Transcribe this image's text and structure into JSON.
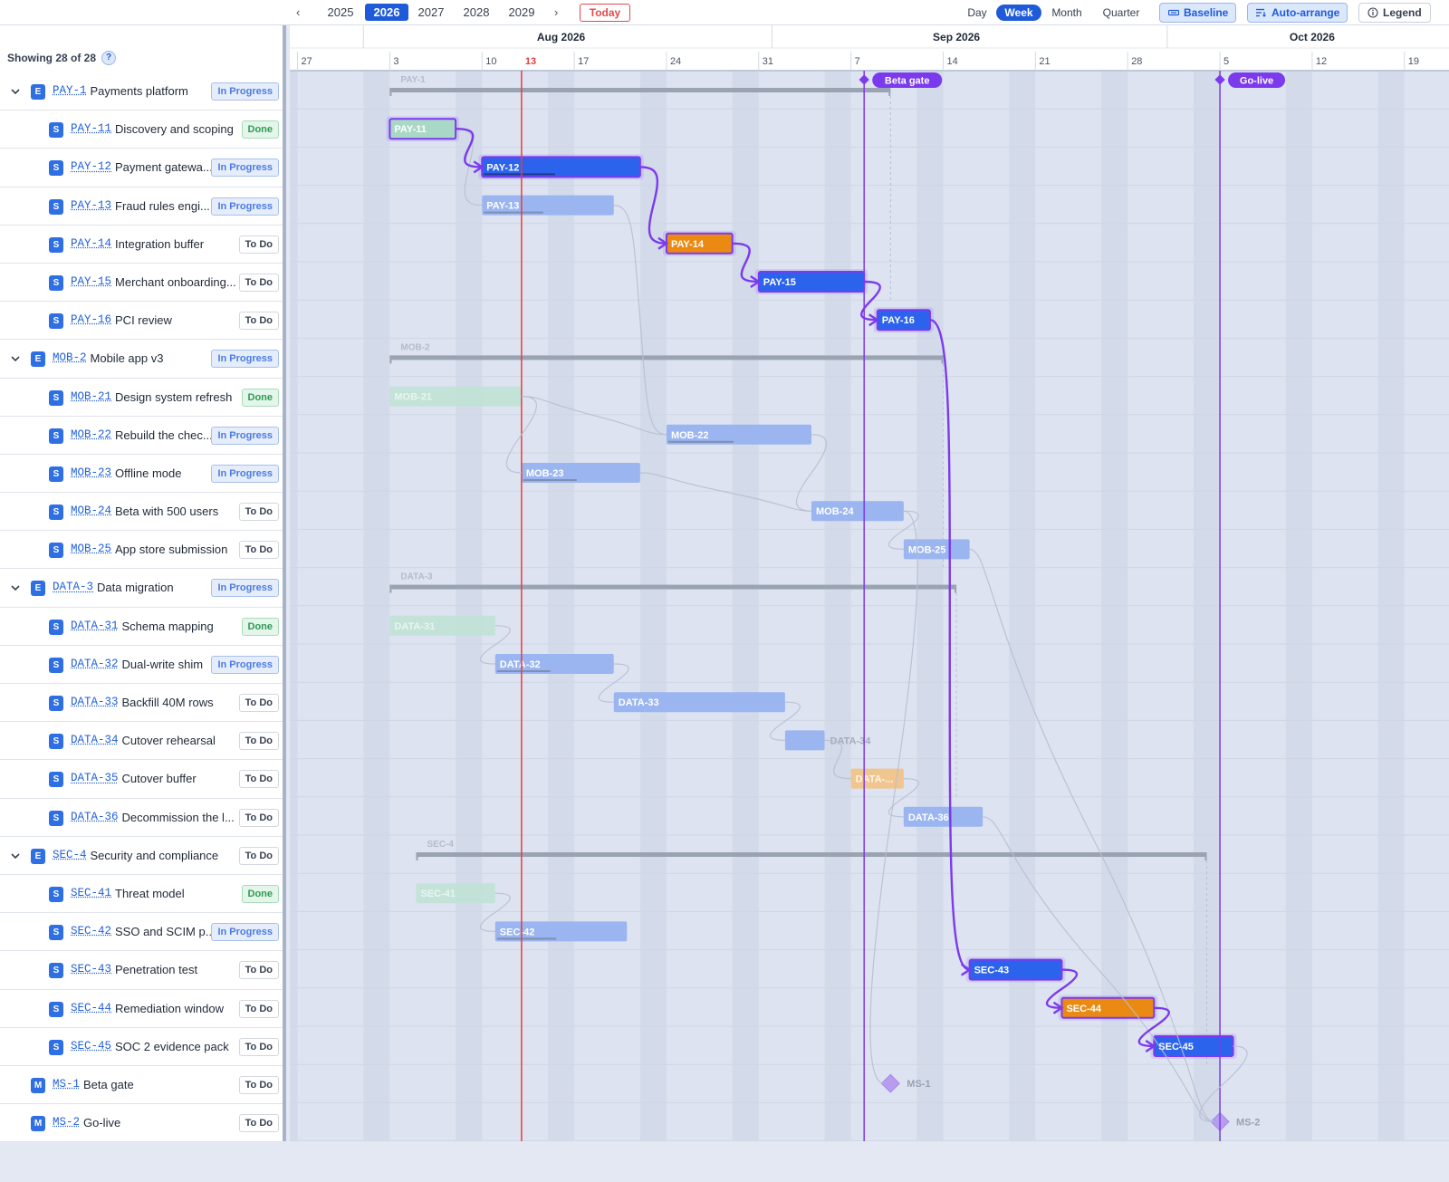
{
  "toolbar": {
    "prev": "‹",
    "next": "›",
    "years": [
      "2025",
      "2026",
      "2027",
      "2028",
      "2029"
    ],
    "active_year": "2026",
    "today": "Today",
    "zooms": [
      "Day",
      "Week",
      "Month",
      "Quarter"
    ],
    "active_zoom": "Week",
    "baseline": "Baseline",
    "auto_arrange": "Auto-arrange",
    "legend": "Legend"
  },
  "panel": {
    "showing": "Showing 28 of 28",
    "help": "?"
  },
  "timeline": {
    "months": [
      "Aug 2026",
      "Sep 2026",
      "Oct 2026"
    ],
    "days": [
      "27",
      "3",
      "10",
      "13",
      "17",
      "24",
      "31",
      "7",
      "14",
      "21",
      "28",
      "5",
      "12",
      "19"
    ],
    "today_label": "13",
    "milestones_top": [
      "Beta gate",
      "Go-live"
    ]
  },
  "rows": [
    {
      "type": "E",
      "key": "PAY-1",
      "title": "Payments platform",
      "status": "In Progress",
      "epic": true
    },
    {
      "type": "S",
      "key": "PAY-11",
      "title": "Discovery and scoping",
      "status": "Done"
    },
    {
      "type": "S",
      "key": "PAY-12",
      "title": "Payment gatewa...",
      "status": "In Progress"
    },
    {
      "type": "S",
      "key": "PAY-13",
      "title": "Fraud rules engi...",
      "status": "In Progress"
    },
    {
      "type": "S",
      "key": "PAY-14",
      "title": "Integration buffer",
      "status": "To Do"
    },
    {
      "type": "S",
      "key": "PAY-15",
      "title": "Merchant onboarding...",
      "status": "To Do"
    },
    {
      "type": "S",
      "key": "PAY-16",
      "title": "PCI review",
      "status": "To Do"
    },
    {
      "type": "E",
      "key": "MOB-2",
      "title": "Mobile app v3",
      "status": "In Progress",
      "epic": true
    },
    {
      "type": "S",
      "key": "MOB-21",
      "title": "Design system refresh",
      "status": "Done"
    },
    {
      "type": "S",
      "key": "MOB-22",
      "title": "Rebuild the chec...",
      "status": "In Progress"
    },
    {
      "type": "S",
      "key": "MOB-23",
      "title": "Offline mode",
      "status": "In Progress"
    },
    {
      "type": "S",
      "key": "MOB-24",
      "title": "Beta with 500 users",
      "status": "To Do"
    },
    {
      "type": "S",
      "key": "MOB-25",
      "title": "App store submission",
      "status": "To Do"
    },
    {
      "type": "E",
      "key": "DATA-3",
      "title": "Data migration",
      "status": "In Progress",
      "epic": true
    },
    {
      "type": "S",
      "key": "DATA-31",
      "title": "Schema mapping",
      "status": "Done"
    },
    {
      "type": "S",
      "key": "DATA-32",
      "title": "Dual-write shim",
      "status": "In Progress"
    },
    {
      "type": "S",
      "key": "DATA-33",
      "title": "Backfill 40M rows",
      "status": "To Do"
    },
    {
      "type": "S",
      "key": "DATA-34",
      "title": "Cutover rehearsal",
      "status": "To Do"
    },
    {
      "type": "S",
      "key": "DATA-35",
      "title": "Cutover buffer",
      "status": "To Do"
    },
    {
      "type": "S",
      "key": "DATA-36",
      "title": "Decommission the l...",
      "status": "To Do"
    },
    {
      "type": "E",
      "key": "SEC-4",
      "title": "Security and compliance",
      "status": "To Do",
      "epic": true
    },
    {
      "type": "S",
      "key": "SEC-41",
      "title": "Threat model",
      "status": "Done"
    },
    {
      "type": "S",
      "key": "SEC-42",
      "title": "SSO and SCIM p...",
      "status": "In Progress"
    },
    {
      "type": "S",
      "key": "SEC-43",
      "title": "Penetration test",
      "status": "To Do"
    },
    {
      "type": "S",
      "key": "SEC-44",
      "title": "Remediation window",
      "status": "To Do"
    },
    {
      "type": "S",
      "key": "SEC-45",
      "title": "SOC 2 evidence pack",
      "status": "To Do"
    },
    {
      "type": "M",
      "key": "MS-1",
      "title": "Beta gate",
      "status": "To Do"
    },
    {
      "type": "M",
      "key": "MS-2",
      "title": "Go-live",
      "status": "To Do"
    }
  ],
  "bars": [
    {
      "label": "PAY-1",
      "start": "2026-08-03",
      "end": "2026-09-10",
      "kind": "epic"
    },
    {
      "label": "PAY-11",
      "start": "2026-08-03",
      "end": "2026-08-08",
      "kind": "done-critical"
    },
    {
      "label": "PAY-12",
      "start": "2026-08-10",
      "end": "2026-08-22",
      "kind": "critical"
    },
    {
      "label": "PAY-13",
      "start": "2026-08-10",
      "end": "2026-08-20",
      "kind": "faded"
    },
    {
      "label": "PAY-14",
      "start": "2026-08-24",
      "end": "2026-08-29",
      "kind": "buffer-critical"
    },
    {
      "label": "PAY-15",
      "start": "2026-08-31",
      "end": "2026-09-08",
      "kind": "critical"
    },
    {
      "label": "PAY-16",
      "start": "2026-09-09",
      "end": "2026-09-13",
      "kind": "critical"
    },
    {
      "label": "MOB-2",
      "start": "2026-08-03",
      "end": "2026-09-14",
      "kind": "epic"
    },
    {
      "label": "MOB-21",
      "start": "2026-08-03",
      "end": "2026-08-13",
      "kind": "done"
    },
    {
      "label": "MOB-22",
      "start": "2026-08-24",
      "end": "2026-09-04",
      "kind": "faded"
    },
    {
      "label": "MOB-23",
      "start": "2026-08-13",
      "end": "2026-08-22",
      "kind": "faded"
    },
    {
      "label": "MOB-24",
      "start": "2026-09-04",
      "end": "2026-09-11",
      "kind": "faded"
    },
    {
      "label": "MOB-25",
      "start": "2026-09-11",
      "end": "2026-09-16",
      "kind": "faded"
    },
    {
      "label": "DATA-3",
      "start": "2026-08-03",
      "end": "2026-09-15",
      "kind": "epic"
    },
    {
      "label": "DATA-31",
      "start": "2026-08-03",
      "end": "2026-08-11",
      "kind": "done"
    },
    {
      "label": "DATA-32",
      "start": "2026-08-11",
      "end": "2026-08-20",
      "kind": "faded"
    },
    {
      "label": "DATA-33",
      "start": "2026-08-20",
      "end": "2026-09-02",
      "kind": "faded"
    },
    {
      "label": "DATA-34",
      "start": "2026-09-02",
      "end": "2026-09-05",
      "kind": "faded-short"
    },
    {
      "label": "DATA-...",
      "start": "2026-09-07",
      "end": "2026-09-11",
      "kind": "buffer-faded"
    },
    {
      "label": "DATA-36",
      "start": "2026-09-11",
      "end": "2026-09-17",
      "kind": "faded"
    },
    {
      "label": "SEC-4",
      "start": "2026-08-05",
      "end": "2026-10-04",
      "kind": "epic"
    },
    {
      "label": "SEC-41",
      "start": "2026-08-05",
      "end": "2026-08-11",
      "kind": "done"
    },
    {
      "label": "SEC-42",
      "start": "2026-08-11",
      "end": "2026-08-21",
      "kind": "faded"
    },
    {
      "label": "SEC-43",
      "start": "2026-09-16",
      "end": "2026-09-23",
      "kind": "critical"
    },
    {
      "label": "SEC-44",
      "start": "2026-09-23",
      "end": "2026-09-30",
      "kind": "buffer-critical"
    },
    {
      "label": "SEC-45",
      "start": "2026-09-30",
      "end": "2026-10-06",
      "kind": "critical"
    },
    {
      "label": "MS-1",
      "date": "2026-09-10",
      "kind": "milestone"
    },
    {
      "label": "MS-2",
      "date": "2026-10-05",
      "kind": "milestone"
    }
  ],
  "markers": [
    {
      "label": "Beta gate",
      "date": "2026-09-08"
    },
    {
      "label": "Go-live",
      "date": "2026-10-05"
    }
  ],
  "today": "2026-08-13",
  "colors": {
    "critical_fill": "#2c63ec",
    "critical_outline": "#7c3aed",
    "buffer": "#ea8a13",
    "faded": "#9bb5f0",
    "done": "#bfe3d3",
    "epic": "#9aa3b2",
    "today_line": "#e53e3e",
    "milestone": "#7c3aed"
  }
}
